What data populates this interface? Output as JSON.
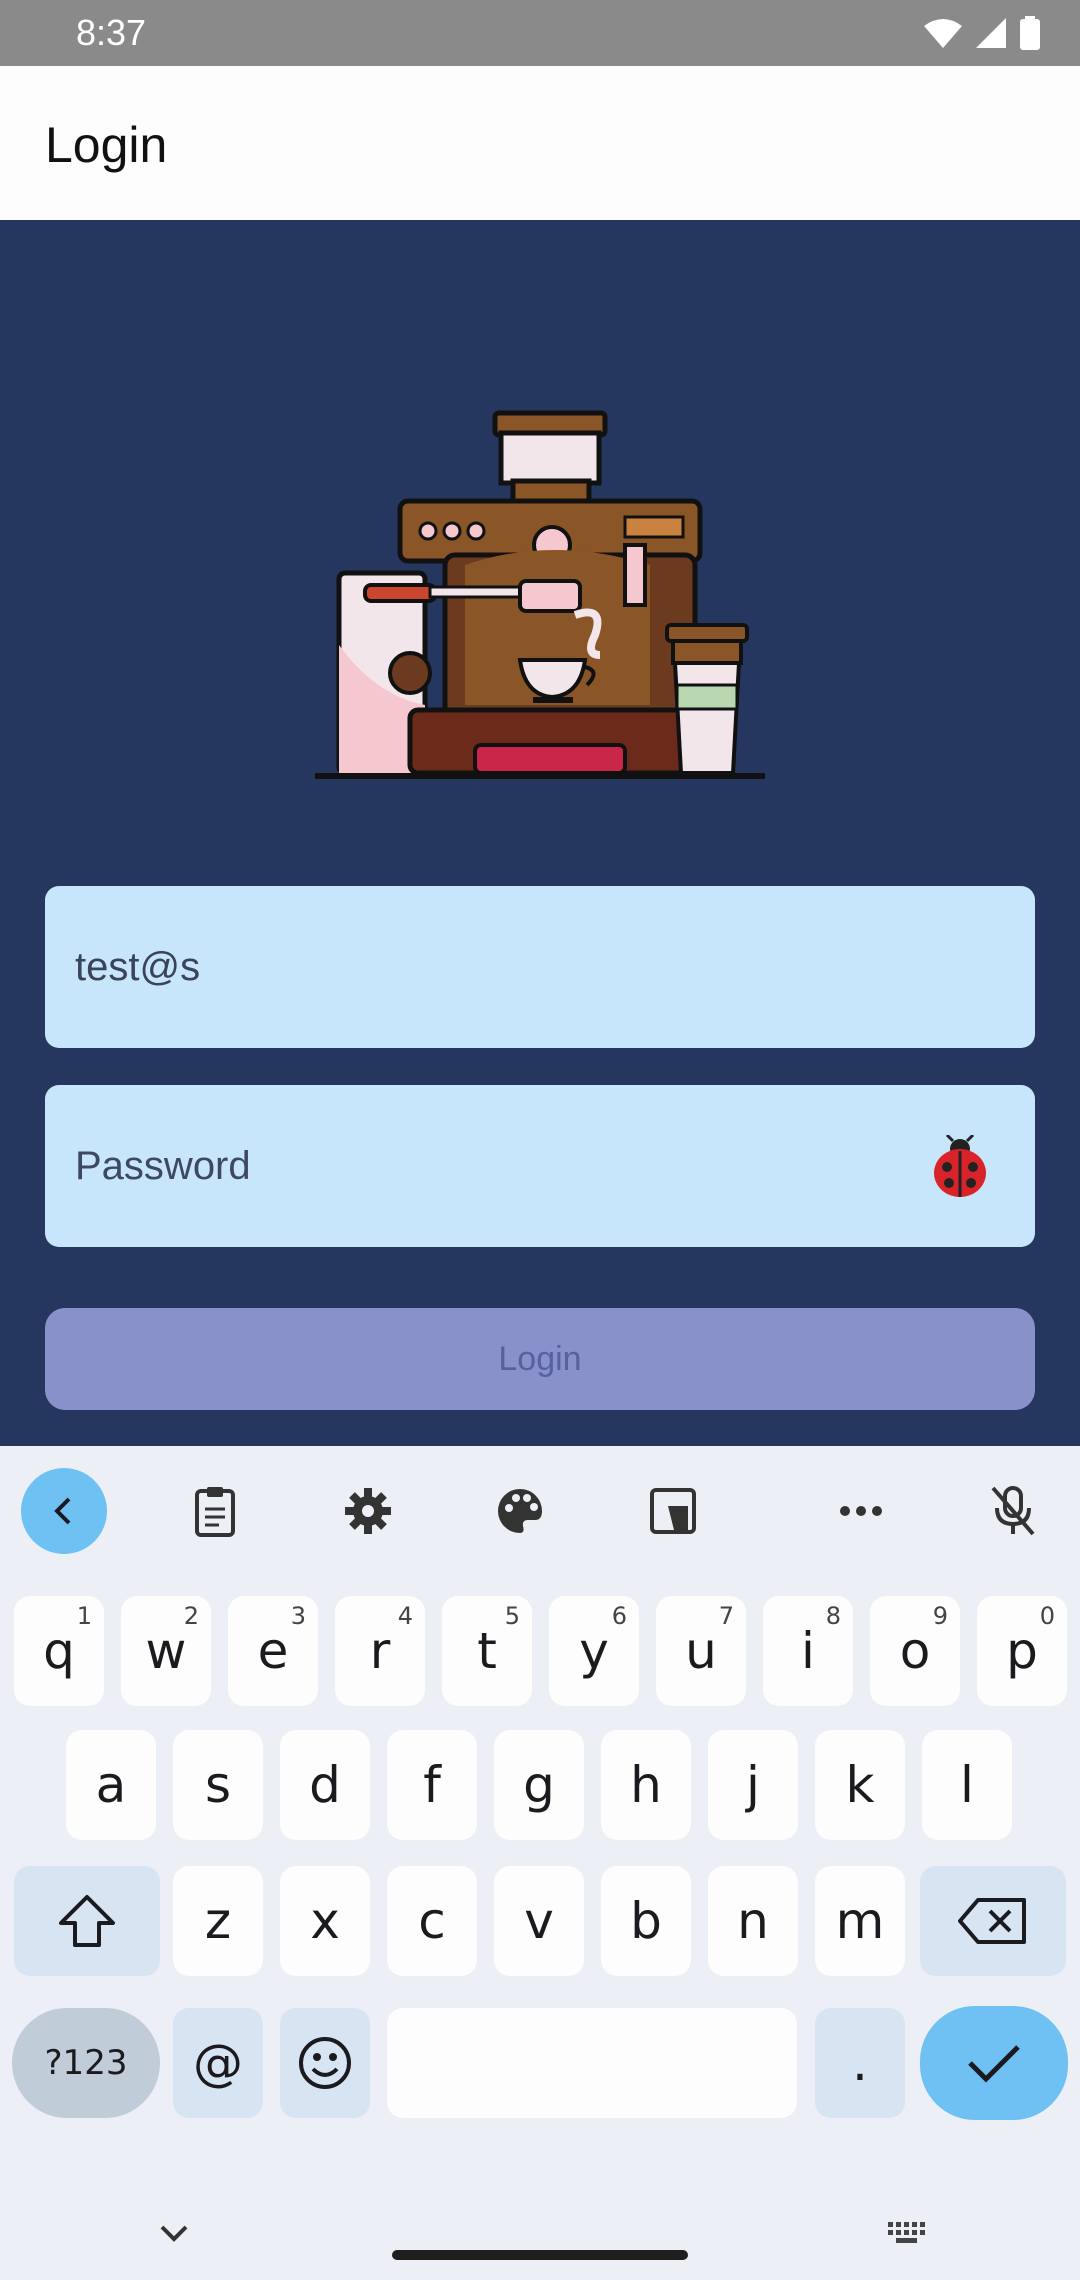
{
  "status_bar": {
    "time": "8:37"
  },
  "app_bar": {
    "title": "Login"
  },
  "form": {
    "email_value": "test@s",
    "email_placeholder": "",
    "password_placeholder": "Password",
    "login_label": "Login"
  },
  "keyboard": {
    "toolbar": [
      "chevron-left-icon",
      "clipboard-icon",
      "gear-icon",
      "palette-icon",
      "floating-keyboard-icon",
      "more-icon",
      "mic-off-icon"
    ],
    "row1": [
      {
        "key": "q",
        "num": "1"
      },
      {
        "key": "w",
        "num": "2"
      },
      {
        "key": "e",
        "num": "3"
      },
      {
        "key": "r",
        "num": "4"
      },
      {
        "key": "t",
        "num": "5"
      },
      {
        "key": "y",
        "num": "6"
      },
      {
        "key": "u",
        "num": "7"
      },
      {
        "key": "i",
        "num": "8"
      },
      {
        "key": "o",
        "num": "9"
      },
      {
        "key": "p",
        "num": "0"
      }
    ],
    "row2": [
      "a",
      "s",
      "d",
      "f",
      "g",
      "h",
      "j",
      "k",
      "l"
    ],
    "row3": [
      "z",
      "x",
      "c",
      "v",
      "b",
      "n",
      "m"
    ],
    "symbols_label": "?123",
    "at_label": "@",
    "period_label": "."
  }
}
